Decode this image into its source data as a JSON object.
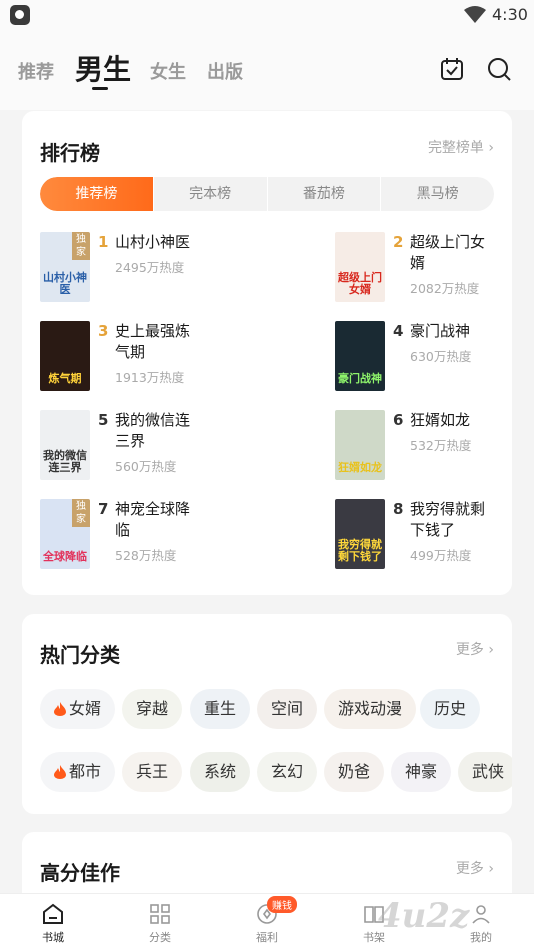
{
  "status_bar": {
    "time": "4:30"
  },
  "top_tabs": [
    {
      "label": "推荐"
    },
    {
      "label": "男生"
    },
    {
      "label": "女生"
    },
    {
      "label": "出版"
    }
  ],
  "ranking": {
    "title": "排行榜",
    "more": "完整榜单 ›",
    "tabs": [
      "推荐榜",
      "完本榜",
      "番茄榜",
      "黑马榜"
    ],
    "books": [
      {
        "rank": "1",
        "title": "山村小神医",
        "heat": "2495万热度",
        "badge": "独家",
        "cover_text": "山村小神医",
        "cover_bg": "#dfe7f1",
        "cover_fg": "#2a5fa8"
      },
      {
        "rank": "2",
        "title": "超级上门女婿",
        "heat": "2082万热度",
        "badge": "",
        "cover_text": "超级上门女婿",
        "cover_bg": "#f6ece6",
        "cover_fg": "#d8281e"
      },
      {
        "rank": "3",
        "title": "史上最强炼气期",
        "heat": "1913万热度",
        "badge": "",
        "cover_text": "炼气期",
        "cover_bg": "#2a1a14",
        "cover_fg": "#ffd23a"
      },
      {
        "rank": "4",
        "title": "豪门战神",
        "heat": "630万热度",
        "badge": "",
        "cover_text": "豪门战神",
        "cover_bg": "#1a2a33",
        "cover_fg": "#8ef36b"
      },
      {
        "rank": "5",
        "title": "我的微信连三界",
        "heat": "560万热度",
        "badge": "",
        "cover_text": "我的微信连三界",
        "cover_bg": "#eef0f2",
        "cover_fg": "#333"
      },
      {
        "rank": "6",
        "title": "狂婿如龙",
        "heat": "532万热度",
        "badge": "",
        "cover_text": "狂婿如龙",
        "cover_bg": "#cfd9c8",
        "cover_fg": "#e8c21e"
      },
      {
        "rank": "7",
        "title": "神宠全球降临",
        "heat": "528万热度",
        "badge": "独家",
        "cover_text": "全球降临",
        "cover_bg": "#d9e3f3",
        "cover_fg": "#e2315b"
      },
      {
        "rank": "8",
        "title": "我穷得就剩下钱了",
        "heat": "499万热度",
        "badge": "",
        "cover_text": "我穷得就剩下钱了",
        "cover_bg": "#3a3a42",
        "cover_fg": "#ffd83a"
      }
    ]
  },
  "hot_categories": {
    "title": "热门分类",
    "more": "更多 ›",
    "row1": [
      {
        "label": "女婿",
        "fire": true,
        "bg": "#f4f5f7"
      },
      {
        "label": "穿越",
        "fire": false,
        "bg": "#f3f4ee"
      },
      {
        "label": "重生",
        "fire": false,
        "bg": "#eef2f6"
      },
      {
        "label": "空间",
        "fire": false,
        "bg": "#f3efec"
      },
      {
        "label": "游戏动漫",
        "fire": false,
        "bg": "#f6f1ec"
      },
      {
        "label": "历史",
        "fire": false,
        "bg": "#eef3f7"
      }
    ],
    "row2": [
      {
        "label": "都市",
        "fire": true,
        "bg": "#f4f5f7"
      },
      {
        "label": "兵王",
        "fire": false,
        "bg": "#f6f3ef"
      },
      {
        "label": "系统",
        "fire": false,
        "bg": "#eef0ea"
      },
      {
        "label": "玄幻",
        "fire": false,
        "bg": "#f3f4ef"
      },
      {
        "label": "奶爸",
        "fire": false,
        "bg": "#f5f1ee"
      },
      {
        "label": "神豪",
        "fire": false,
        "bg": "#f3f2f6"
      },
      {
        "label": "武侠",
        "fire": false,
        "bg": "#f1f1ec"
      }
    ]
  },
  "high_score": {
    "title": "高分佳作",
    "more": "更多 ›"
  },
  "bottom_nav": [
    {
      "label": "书城",
      "icon": "home-icon"
    },
    {
      "label": "分类",
      "icon": "grid-icon"
    },
    {
      "label": "福利",
      "icon": "coin-icon",
      "badge": "赚钱"
    },
    {
      "label": "书架",
      "icon": "book-icon"
    },
    {
      "label": "我的",
      "icon": "user-icon"
    }
  ],
  "watermark": "4u2z",
  "colors": {
    "accent": "#ff6a1a",
    "rank_top": "#e5a33a",
    "rank_other": "#333333"
  }
}
